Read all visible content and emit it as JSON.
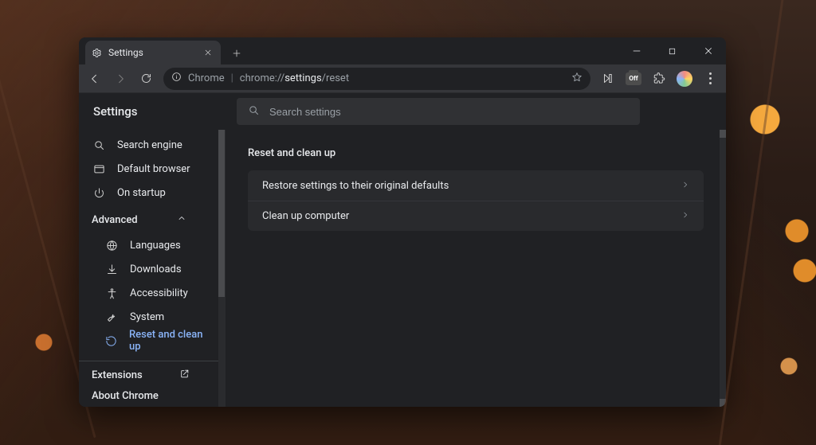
{
  "tab": {
    "title": "Settings"
  },
  "omnibox": {
    "scheme_label": "Chrome",
    "path_prefix": "chrome://",
    "path_bold": "settings",
    "path_rest": "/reset"
  },
  "toolbar_ext_badge": "Off",
  "page": {
    "title": "Settings",
    "search_placeholder": "Search settings"
  },
  "sidebar": {
    "items_top": [
      {
        "icon": "search",
        "label": "Search engine"
      },
      {
        "icon": "browser",
        "label": "Default browser"
      },
      {
        "icon": "power",
        "label": "On startup"
      }
    ],
    "advanced_label": "Advanced",
    "items_adv": [
      {
        "icon": "globe",
        "label": "Languages"
      },
      {
        "icon": "download",
        "label": "Downloads"
      },
      {
        "icon": "a11y",
        "label": "Accessibility"
      },
      {
        "icon": "wrench",
        "label": "System"
      },
      {
        "icon": "restore",
        "label": "Reset and clean up",
        "active": true
      }
    ],
    "footer": [
      {
        "label": "Extensions",
        "external": true
      },
      {
        "label": "About Chrome"
      }
    ]
  },
  "main": {
    "section_title": "Reset and clean up",
    "rows": [
      "Restore settings to their original defaults",
      "Clean up computer"
    ]
  }
}
